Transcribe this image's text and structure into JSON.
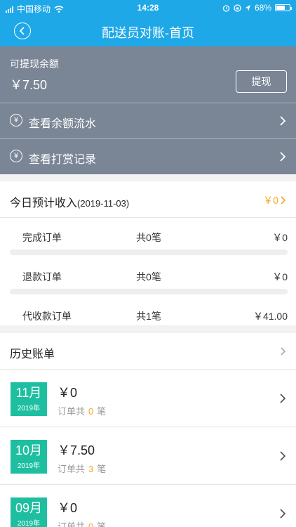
{
  "status_bar": {
    "carrier": "中国移动",
    "time": "14:28",
    "battery": "68%",
    "battery_level": 0.68
  },
  "header": {
    "title": "配送员对账-首页"
  },
  "balance": {
    "label": "可提现余额",
    "amount": "￥7.50",
    "withdraw_label": "提现"
  },
  "links": [
    {
      "label": "查看余额流水",
      "icon": "yen-coin-icon"
    },
    {
      "label": "查看打赏记录",
      "icon": "yen-coin-icon"
    }
  ],
  "today": {
    "title": "今日预计收入",
    "date": "(2019-11-03)",
    "total": "￥0",
    "rows": [
      {
        "name": "完成订单",
        "count": "共0笔",
        "amount": "￥0"
      },
      {
        "name": "退款订单",
        "count": "共0笔",
        "amount": "￥0"
      },
      {
        "name": "代收款订单",
        "count": "共1笔",
        "amount": "￥41.00"
      }
    ]
  },
  "history": {
    "title": "历史账单",
    "items": [
      {
        "month": "11月",
        "year": "2019年",
        "amount": "￥0",
        "orders_prefix": "订单共",
        "orders_count": "0",
        "orders_suffix": "笔"
      },
      {
        "month": "10月",
        "year": "2019年",
        "amount": "￥7.50",
        "orders_prefix": "订单共",
        "orders_count": "3",
        "orders_suffix": "笔"
      },
      {
        "month": "09月",
        "year": "2019年",
        "amount": "￥0",
        "orders_prefix": "订单共",
        "orders_count": "0",
        "orders_suffix": "笔"
      }
    ]
  },
  "colors": {
    "header": "#1ea8e8",
    "panel": "#7a8595",
    "accent": "#f5a623",
    "month_box": "#1dbfa0"
  }
}
